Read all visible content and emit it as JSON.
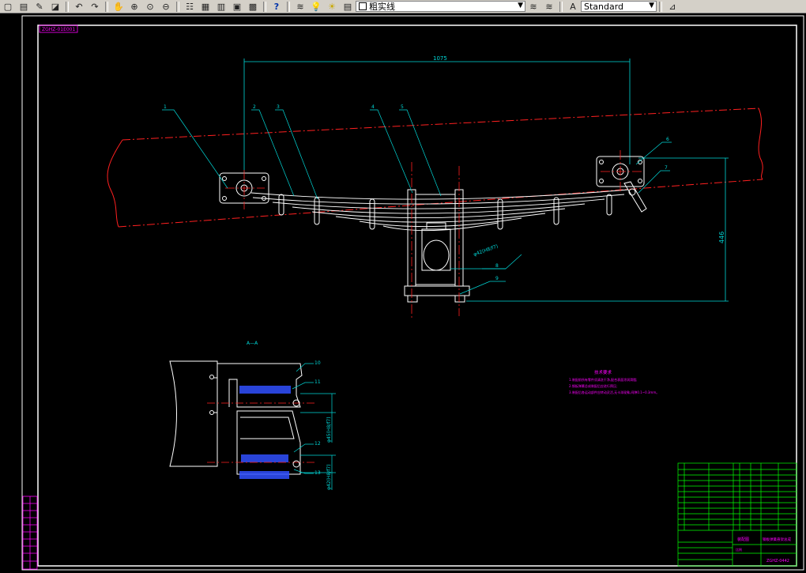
{
  "toolbar": {
    "layer_name": "粗实线",
    "text_style": "Standard",
    "icons": [
      "new-icon",
      "open-icon",
      "pencil-icon",
      "brush-icon",
      "undo-icon",
      "redo-icon",
      "pan-icon",
      "zoom-realtime-icon",
      "zoom-window-icon",
      "zoom-previous-icon",
      "properties-icon",
      "design-center-icon",
      "tool-palette-icon",
      "sheet-set-icon",
      "calc-icon",
      "help-icon",
      "layer-manager-icon",
      "layer-bulb-icon",
      "layer-sun-icon",
      "layer-lock-icon",
      "layer-color-icon",
      "make-current-icon",
      "layer-previous-icon",
      "text-style-icon",
      "dim-style-icon"
    ]
  },
  "colors": {
    "background": "#000000",
    "frame": "#ffffff",
    "centerline": "#ff2020",
    "dimension": "#00d8d8",
    "annotation": "#ff00ff",
    "titleblock": "#00ff00"
  },
  "drawing": {
    "drawing_number": "ZGHZ-01E001",
    "dim_length": "1075",
    "dim_height": "446",
    "dim_pin_main": "φ42(H8/f7)",
    "dim_pin_1": "φ45(H8/f7)",
    "dim_pin_2": "φ42(H8/f7)",
    "section_label": "A—A",
    "leaders_main": [
      "1",
      "2",
      "3",
      "4",
      "5",
      "6",
      "7",
      "8",
      "9"
    ],
    "leaders_section": [
      "10",
      "11",
      "12",
      "13"
    ],
    "tech_req_title": "技术要求",
    "tech_req_lines": [
      "1.装配前所有零件须清洗干净,配合表面涂润滑脂;",
      "2.钢板弹簧总成装配后应进行预压;",
      "3.装配后各运动部件应转动灵活,无卡滞现象,间隙0.1~0.3mm。"
    ],
    "titleblock_name": "钢板弹簧悬架总成",
    "titleblock_code": "ZGHZ-0442",
    "titleblock_company": "装配图",
    "titleblock_scale": "比例"
  }
}
